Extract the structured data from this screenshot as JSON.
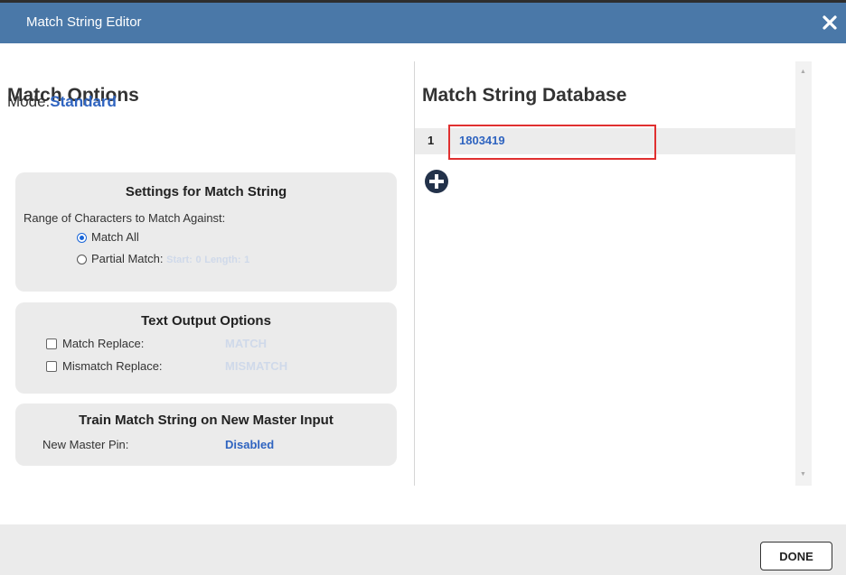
{
  "dialog": {
    "title": "Match String Editor"
  },
  "match_options": {
    "heading": "Match Options",
    "mode_label": "Mode:",
    "mode_value": "Standard",
    "settings": {
      "heading": "Settings for Match String",
      "range_label": "Range of Characters to Match Against:",
      "match_all_label": "Match All",
      "match_all_selected": true,
      "partial_label": "Partial Match:",
      "start_label": "Start:",
      "start_value": "0",
      "length_label": "Length:",
      "length_value": "1"
    },
    "text_output": {
      "heading": "Text Output Options",
      "match_replace_label": "Match Replace:",
      "match_replace_value": "MATCH",
      "mismatch_replace_label": "Mismatch Replace:",
      "mismatch_replace_value": "MISMATCH"
    },
    "train": {
      "heading": "Train Match String on New Master Input",
      "pin_label": "New Master Pin:",
      "pin_value": "Disabled"
    }
  },
  "database": {
    "heading": "Match String Database",
    "rows": [
      {
        "index": "1",
        "value": "1803419"
      }
    ]
  },
  "footer": {
    "done_label": "DONE"
  }
}
